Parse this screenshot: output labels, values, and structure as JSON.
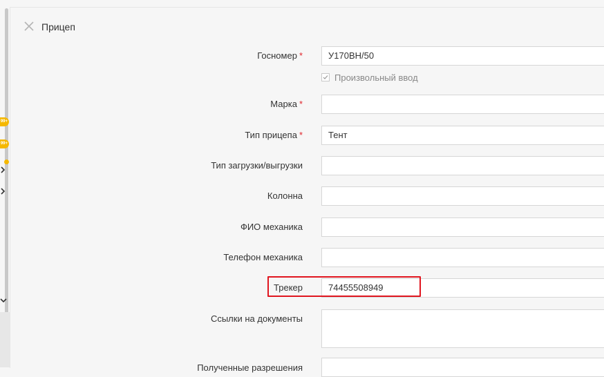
{
  "sidebar": {
    "badges": [
      "99+",
      "99+"
    ]
  },
  "panel": {
    "title": "Прицеп",
    "fields": {
      "gosnomer": {
        "label": "Госномер",
        "required_mark": "*",
        "value": "У170ВН/50"
      },
      "free_input": {
        "label": "Произвольный ввод",
        "checked": true
      },
      "marka": {
        "label": "Марка",
        "required_mark": "*",
        "value": ""
      },
      "trailer_type": {
        "label": "Тип прицепа",
        "required_mark": "*",
        "value": "Тент"
      },
      "load_type": {
        "label": "Тип загрузки/выгрузки",
        "value": ""
      },
      "column": {
        "label": "Колонна",
        "value": ""
      },
      "mechanic_name": {
        "label": "ФИО механика",
        "value": ""
      },
      "mechanic_phone": {
        "label": "Телефон механика",
        "value": ""
      },
      "tracker": {
        "label": "Трекер",
        "value": "74455508949"
      },
      "doc_links": {
        "label": "Ссылки на документы",
        "value": ""
      },
      "permissions": {
        "label": "Полученные разрешения",
        "value": ""
      }
    }
  },
  "colors": {
    "required": "#e0262d",
    "highlight": "#e0141e",
    "badge": "#f5b800"
  }
}
